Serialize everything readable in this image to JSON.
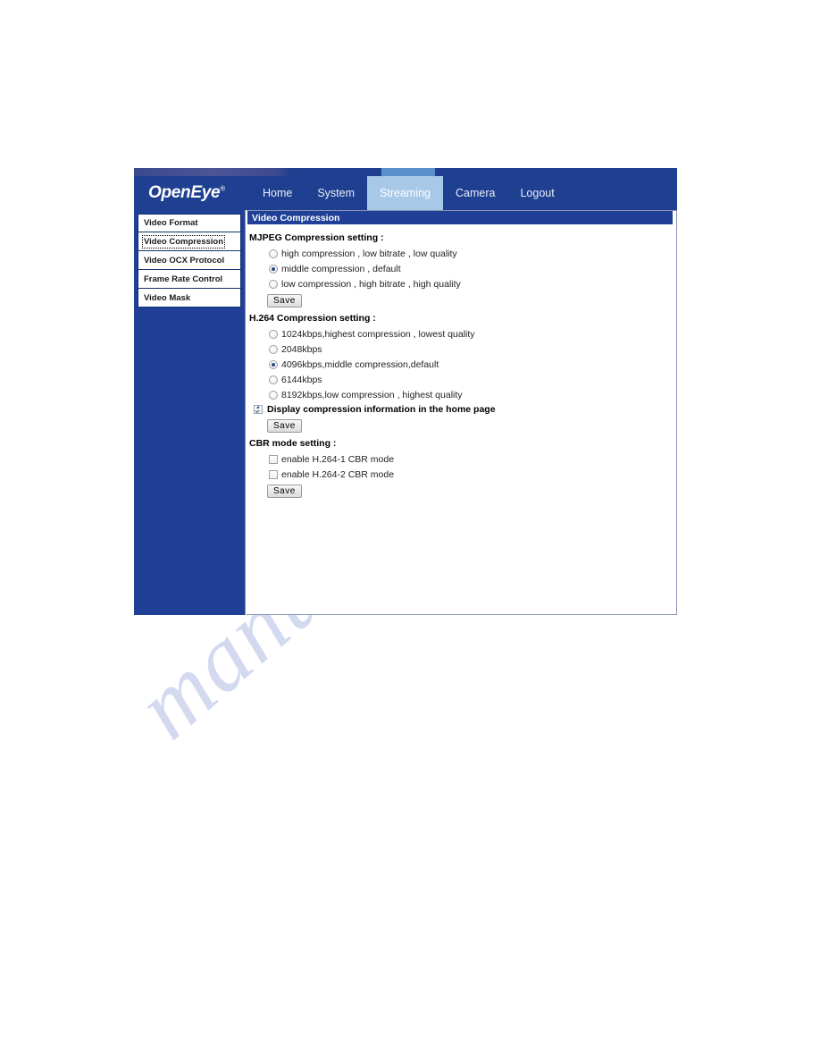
{
  "watermark": {
    "text": "manualshive.com"
  },
  "header": {
    "logo": "OpenEye",
    "logo_mark": "®",
    "nav": [
      {
        "label": "Home",
        "active": false
      },
      {
        "label": "System",
        "active": false
      },
      {
        "label": "Streaming",
        "active": true
      },
      {
        "label": "Camera",
        "active": false
      },
      {
        "label": "Logout",
        "active": false
      }
    ]
  },
  "sidebar": {
    "items": [
      {
        "label": "Video Format",
        "selected": false
      },
      {
        "label": "Video Compression",
        "selected": true
      },
      {
        "label": "Video OCX Protocol",
        "selected": false
      },
      {
        "label": "Frame Rate Control",
        "selected": false
      },
      {
        "label": "Video Mask",
        "selected": false
      }
    ]
  },
  "panel": {
    "title": "Video Compression",
    "mjpeg": {
      "heading": "MJPEG Compression setting :",
      "options": [
        {
          "label": "high compression , low bitrate , low quality",
          "checked": false
        },
        {
          "label": "middle compression , default",
          "checked": true
        },
        {
          "label": "low compression , high bitrate , high quality",
          "checked": false
        }
      ],
      "save_label": "Save"
    },
    "h264": {
      "heading": "H.264 Compression setting :",
      "options": [
        {
          "label": "1024kbps,highest compression , lowest quality",
          "checked": false
        },
        {
          "label": "2048kbps",
          "checked": false
        },
        {
          "label": "4096kbps,middle compression,default",
          "checked": true
        },
        {
          "label": "6144kbps",
          "checked": false
        },
        {
          "label": "8192kbps,low compression , highest quality",
          "checked": false
        }
      ]
    },
    "display_info": {
      "label": "Display compression information in the home page",
      "checked": true,
      "save_label": "Save"
    },
    "cbr": {
      "heading": "CBR mode setting :",
      "options": [
        {
          "label": "enable H.264-1 CBR mode",
          "checked": false
        },
        {
          "label": "enable H.264-2 CBR mode",
          "checked": false
        }
      ],
      "save_label": "Save"
    }
  },
  "colors": {
    "header_blue": "#1f3f91",
    "sidebar_blue": "#1f4096",
    "active_tab": "#a8c8e8",
    "title_bar": "#1f4096",
    "watermark": "#b9c4e8"
  }
}
